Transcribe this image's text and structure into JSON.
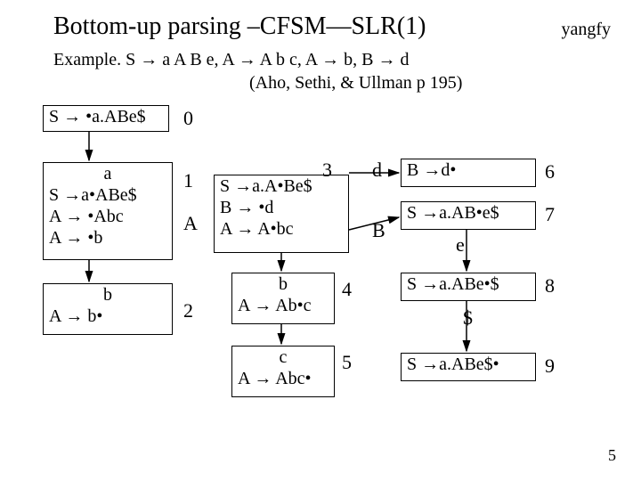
{
  "title": "Bottom-up parsing –CFSM—SLR(1)",
  "author": "yangfy",
  "example_line": "Example. S → a A B e, A → A b c, A → b, B → d",
  "example_ref": "(Aho, Sethi, & Ullman p 195)",
  "page_number": "5",
  "states": {
    "s0": {
      "num": "0",
      "items": [
        "S → •a.ABe$"
      ]
    },
    "s1": {
      "num": "1",
      "anum": "A",
      "head": "a",
      "items": [
        "S →a•ABe$",
        "A → •Abc",
        "A → •b"
      ]
    },
    "s2": {
      "num": "2",
      "head": "b",
      "items": [
        "A → b•"
      ]
    },
    "s3": {
      "num": "3",
      "items": [
        "S →a.A•Be$",
        "B → •d",
        "A → A•bc"
      ]
    },
    "s4": {
      "num": "4",
      "head": "b",
      "items": [
        "A → Ab•c"
      ]
    },
    "s5": {
      "num": "5",
      "head": "c",
      "items": [
        "A → Abc•"
      ]
    },
    "s6": {
      "num": "6",
      "items": [
        "B →d•"
      ]
    },
    "s7": {
      "num": "7",
      "items": [
        "S →a.AB•e$"
      ]
    },
    "s8": {
      "num": "8",
      "items": [
        "S →a.ABe•$"
      ]
    },
    "s9": {
      "num": "9",
      "items": [
        "S →a.ABe$•"
      ]
    }
  },
  "edge_labels": {
    "d": "d",
    "B": "B",
    "e": "e",
    "dollar": "$"
  }
}
